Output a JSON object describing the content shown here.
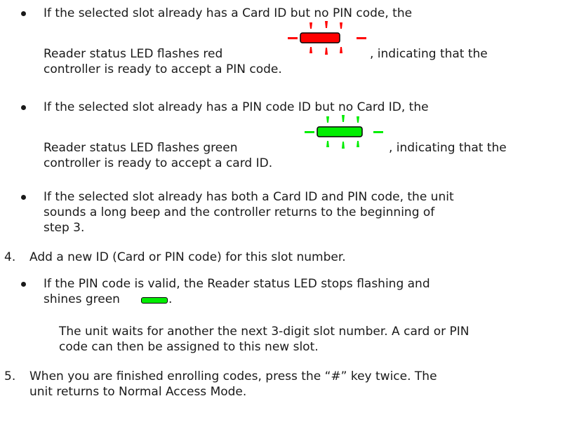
{
  "bullet1": {
    "line1": "If the selected slot already has a Card ID but no PIN code, the",
    "line2_pre": "Reader status LED flashes red",
    "line2_post": ", indicating that the",
    "line3": "controller is ready to accept a PIN code."
  },
  "bullet2": {
    "line1": "If the selected slot already has a PIN code ID but no Card ID, the",
    "line2_pre": "Reader status LED flashes green",
    "line2_post": ", indicating that the",
    "line3": "controller is ready to accept a card ID."
  },
  "bullet3": {
    "line1": "If the selected slot already has both a Card ID and PIN code, the unit",
    "line2": "sounds a long beep and the controller returns to the beginning of",
    "line3": "step 3."
  },
  "step4": {
    "number": "4.",
    "text": "Add a new ID (Card or PIN code) for this slot number."
  },
  "bullet4": {
    "line1": "If the PIN code is valid, the Reader status LED stops flashing and",
    "line2_pre": "shines green",
    "line2_post": "."
  },
  "note": {
    "line1": "The unit waits for another the next 3-digit slot number. A card or PIN",
    "line2": "code can then be assigned to this new slot."
  },
  "step5": {
    "number": "5.",
    "line1": "When you are finished enrolling codes, press the “#” key twice. The",
    "line2": "unit returns to Normal Access Mode."
  },
  "icons": {
    "red_led": "red-flashing-led-icon",
    "green_led": "green-flashing-led-icon",
    "steady_green_led": "green-steady-led-icon"
  },
  "colors": {
    "red": "#ff0000",
    "green": "#00ee00"
  }
}
